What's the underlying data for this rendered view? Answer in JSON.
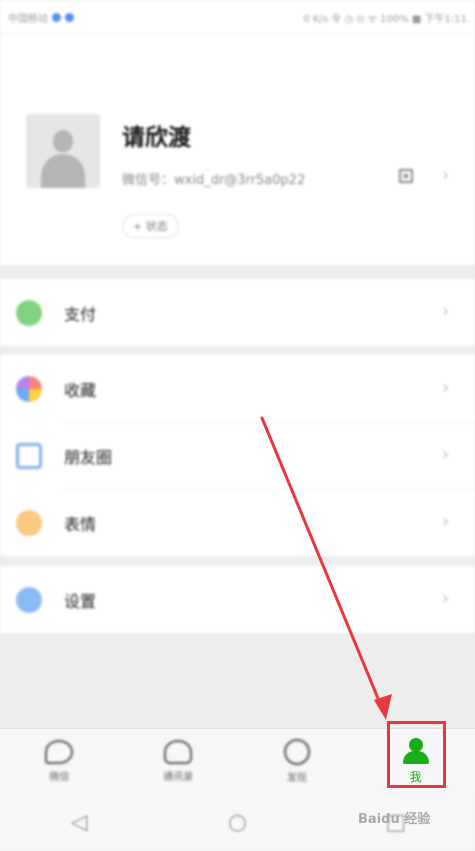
{
  "status_bar": {
    "carrier": "中国移动",
    "right": "0 K/s  令 ◷ ⊙ ᯤ 100% ■ 下午1:11"
  },
  "profile": {
    "nickname": "请欣渡",
    "wechat_id": "微信号：wxid_dr@3rr5a0p22",
    "status_button": "+ 状态"
  },
  "menu": {
    "pay": "支付",
    "favorites": "收藏",
    "moments": "朋友圈",
    "stickers": "表情",
    "settings": "设置"
  },
  "tabbar": {
    "chats": "微信",
    "contacts": "通讯录",
    "discover": "发现",
    "me": "我"
  },
  "watermark": "Baidu 经验",
  "colors": {
    "brand_green": "#1aad19",
    "annotation_red": "#e8383d"
  },
  "icons": [
    "chat-icon",
    "contacts-icon",
    "discover-icon",
    "person-icon",
    "qr-code-icon",
    "chevron-right-icon"
  ]
}
